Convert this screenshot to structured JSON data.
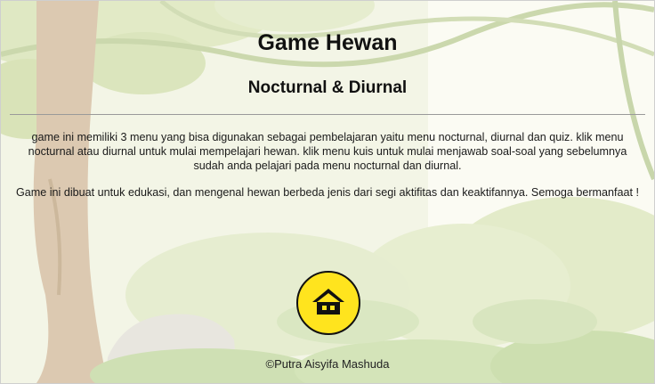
{
  "header": {
    "title": "Game Hewan",
    "subtitle": "Nocturnal & Diurnal"
  },
  "description": {
    "paragraph_1": "game ini memiliki 3 menu yang bisa digunakan sebagai pembelajaran yaitu menu nocturnal, diurnal dan quiz. klik menu nocturnal atau diurnal untuk mulai mempelajari hewan. klik menu kuis untuk mulai menjawab soal-soal yang sebelumnya sudah anda pelajari pada menu nocturnal dan diurnal.",
    "paragraph_2": "Game ini dibuat untuk edukasi, dan mengenal hewan berbeda jenis dari segi aktifitas dan keaktifannya. Semoga bermanfaat !"
  },
  "home_button": {
    "icon": "home-icon",
    "color": "#ffe41e"
  },
  "footer": {
    "credit": "©Putra Aisyifa Mashuda"
  }
}
